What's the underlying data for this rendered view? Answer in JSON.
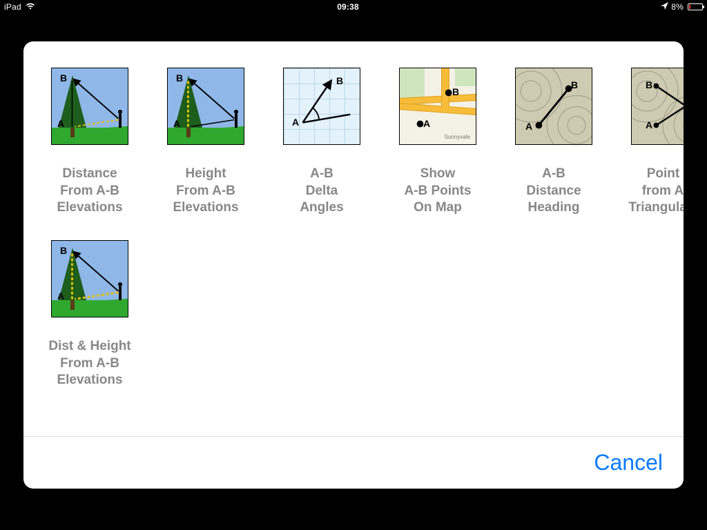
{
  "status": {
    "device": "iPad",
    "time": "09:38",
    "battery_pct": "8%",
    "battery_level": 8
  },
  "sheet": {
    "items": [
      {
        "id": "distance-ab-elev",
        "label": "Distance\nFrom A-B\nElevations"
      },
      {
        "id": "height-ab-elev",
        "label": "Height\nFrom A-B\nElevations"
      },
      {
        "id": "ab-delta-angles",
        "label": "A-B\nDelta\nAngles"
      },
      {
        "id": "show-ab-map",
        "label": "Show\nA-B Points\nOn Map"
      },
      {
        "id": "ab-dist-heading",
        "label": "A-B\nDistance\nHeading"
      },
      {
        "id": "point-c-triang",
        "label": "Point C\nfrom A-B\nTriangulation"
      },
      {
        "id": "dist-height-ab",
        "label": "Dist & Height\nFrom A-B\nElevations"
      }
    ],
    "cancel": "Cancel",
    "map_city": "Sunnyvale"
  }
}
